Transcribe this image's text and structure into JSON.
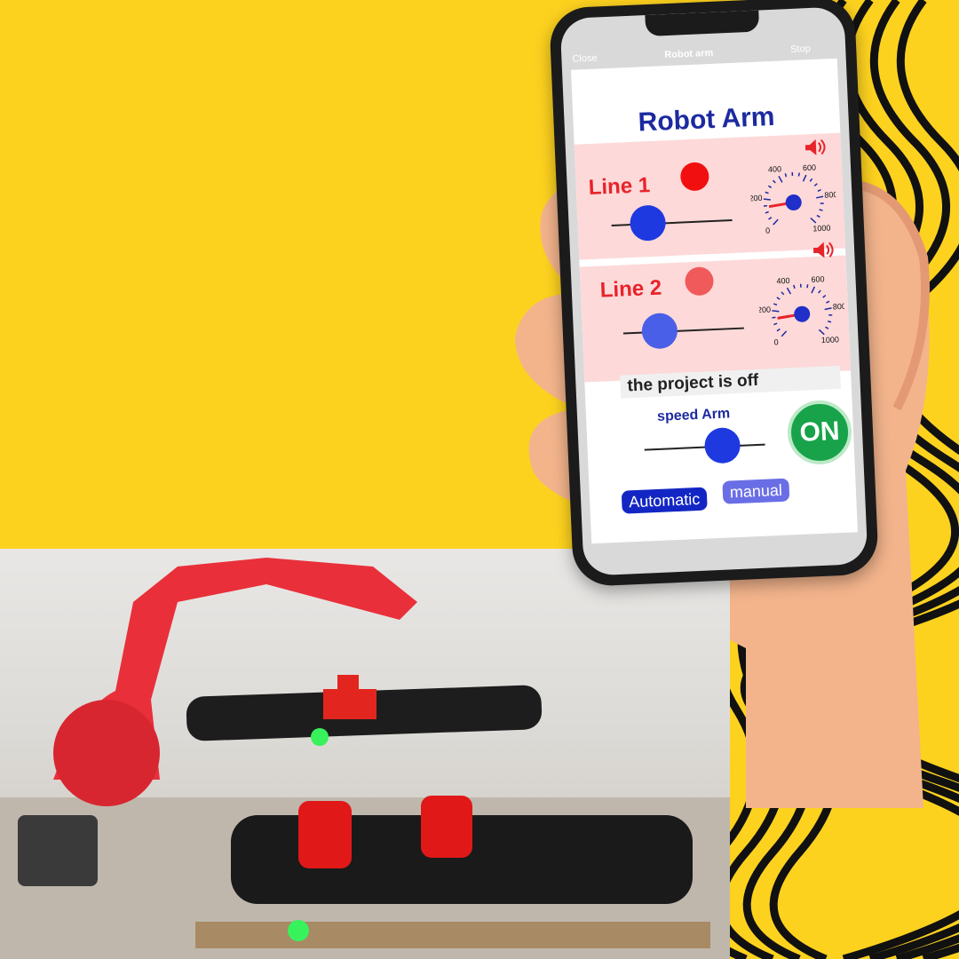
{
  "window": {
    "close_label": "Close",
    "title": "Robot arm",
    "stop_label": "Stop"
  },
  "app": {
    "title": "Robot Arm"
  },
  "lines": [
    {
      "label": "Line 1",
      "indicator_color": "#f20f0f",
      "slider_level": 0.3,
      "gauge_ticks": [
        "0",
        "200",
        "400",
        "600",
        "800",
        "1000"
      ],
      "gauge_value": 140
    },
    {
      "label": "Line 2",
      "indicator_color": "#f05a5a",
      "slider_level": 0.3,
      "gauge_ticks": [
        "0",
        "200",
        "400",
        "600",
        "800",
        "1000"
      ],
      "gauge_value": 140
    }
  ],
  "status": {
    "text": "the project is off"
  },
  "speed": {
    "label": "speed Arm",
    "level": 0.65
  },
  "power_button": {
    "label": "ON"
  },
  "modes": {
    "automatic": "Automatic",
    "manual": "manual"
  },
  "colors": {
    "background": "#fdd21f",
    "accent_blue": "#1c2aa0",
    "line_red": "#e8232a",
    "on_green": "#18a34a"
  }
}
